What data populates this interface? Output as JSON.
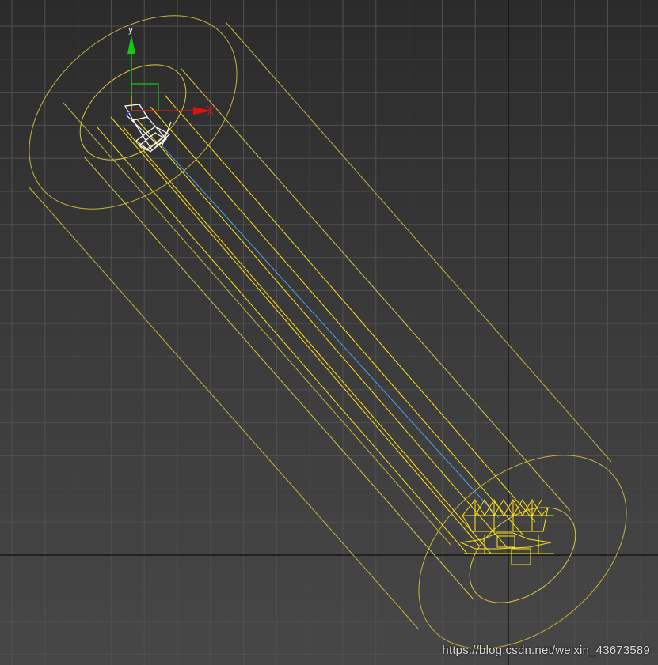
{
  "viewport": {
    "axis_y_label": "y",
    "watermark": "https://blog.csdn.net/weixin_43673589"
  },
  "colors": {
    "grid": "#505050",
    "world_axis": "#0c0c0c",
    "light_cone": "#c9b43a",
    "selected_wire": "#ffe11a",
    "target_line": "#4aa6e8",
    "gizmo_x": "#e01010",
    "gizmo_y": "#14c814",
    "gizmo_z": "#2040ff",
    "icon_white": "#ffffff"
  },
  "icons": [
    "directional-light-icon",
    "target-object-icon",
    "transform-gizmo-icon"
  ]
}
